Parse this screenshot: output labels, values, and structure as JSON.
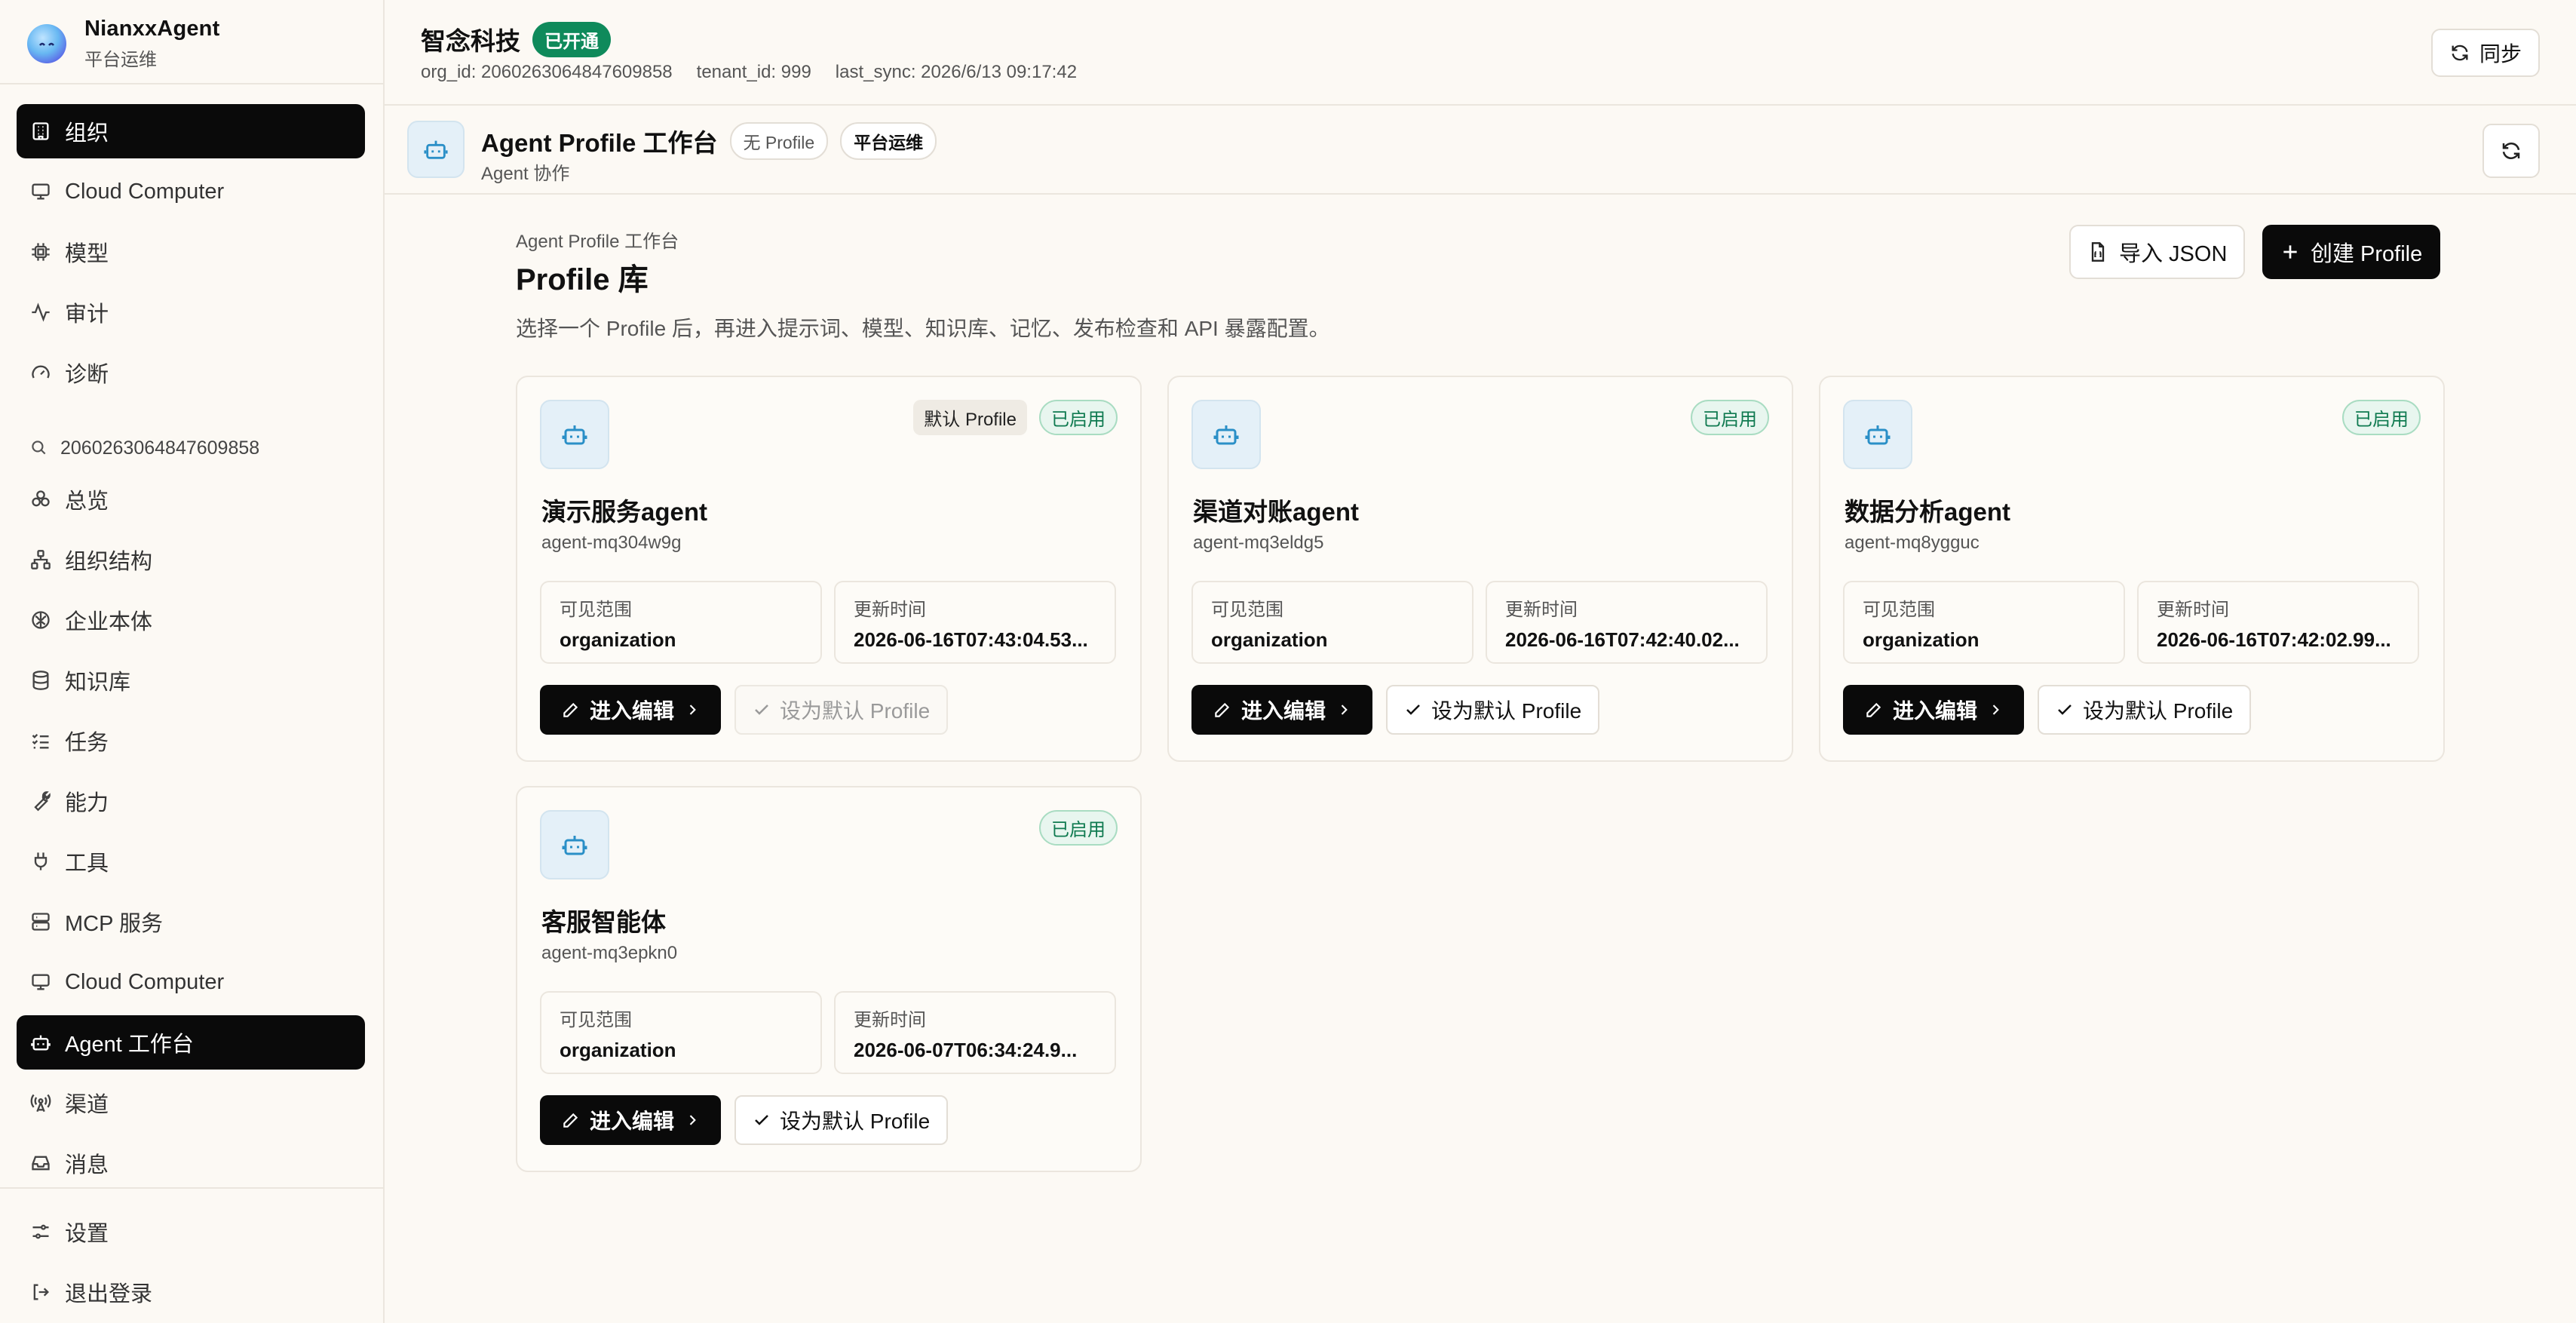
{
  "brand": {
    "name": "NianxxAgent",
    "subtitle": "平台运维"
  },
  "nav": {
    "top_items": [
      {
        "label": "组织",
        "icon": "building-icon"
      },
      {
        "label": "Cloud Computer",
        "icon": "monitor-icon"
      },
      {
        "label": "模型",
        "icon": "chip-icon"
      },
      {
        "label": "审计",
        "icon": "activity-icon"
      },
      {
        "label": "诊断",
        "icon": "gauge-icon"
      }
    ],
    "org_search": "2060263064847609858",
    "org_items": [
      {
        "label": "总览",
        "icon": "overview-icon"
      },
      {
        "label": "组织结构",
        "icon": "org-structure-icon"
      },
      {
        "label": "企业本体",
        "icon": "brain-icon"
      },
      {
        "label": "知识库",
        "icon": "database-icon"
      },
      {
        "label": "任务",
        "icon": "tasks-icon"
      },
      {
        "label": "能力",
        "icon": "wrench-icon"
      },
      {
        "label": "工具",
        "icon": "plug-icon"
      },
      {
        "label": "MCP 服务",
        "icon": "server-icon"
      },
      {
        "label": "Cloud Computer",
        "icon": "monitor-icon"
      },
      {
        "label": "Agent 工作台",
        "icon": "bot-icon"
      },
      {
        "label": "渠道",
        "icon": "antenna-icon"
      },
      {
        "label": "消息",
        "icon": "inbox-icon"
      }
    ],
    "bottom_items": [
      {
        "label": "设置",
        "icon": "sliders-icon"
      },
      {
        "label": "退出登录",
        "icon": "logout-icon"
      }
    ]
  },
  "header": {
    "org_name": "智念科技",
    "status": "已开通",
    "org_id": "org_id: 2060263064847609858",
    "tenant_id": "tenant_id: 999",
    "last_sync": "last_sync: 2026/6/13 09:17:42",
    "sync_label": "同步"
  },
  "subheader": {
    "title": "Agent Profile 工作台",
    "chip_profile": "无 Profile",
    "chip_role": "平台运维",
    "caption": "Agent 协作"
  },
  "main": {
    "breadcrumb": "Agent Profile 工作台",
    "title": "Profile 库",
    "description": "选择一个 Profile 后，再进入提示词、模型、知识库、记忆、发布检查和 API 暴露配置。",
    "import_label": "导入 JSON",
    "create_label": "创建 Profile"
  },
  "labels": {
    "visibility": "可见范围",
    "updated": "更新时间",
    "edit": "进入编辑",
    "set_default": "设为默认 Profile",
    "default_badge": "默认 Profile",
    "enabled_badge": "已启用"
  },
  "profiles": [
    {
      "name": "演示服务agent",
      "id": "agent-mq304w9g",
      "visibility": "organization",
      "updated": "2026-06-16T07:43:04.53...",
      "is_default": true
    },
    {
      "name": "渠道对账agent",
      "id": "agent-mq3eldg5",
      "visibility": "organization",
      "updated": "2026-06-16T07:42:40.02...",
      "is_default": false
    },
    {
      "name": "数据分析agent",
      "id": "agent-mq8ygguc",
      "visibility": "organization",
      "updated": "2026-06-16T07:42:02.99...",
      "is_default": false
    },
    {
      "name": "客服智能体",
      "id": "agent-mq3epkn0",
      "visibility": "organization",
      "updated": "2026-06-07T06:34:24.9...",
      "is_default": false
    }
  ],
  "colors": {
    "accent": "#0a0a0a",
    "status_green": "#0f8a5b",
    "icon_tint": "#2a8fc7",
    "background": "#fcf9f4"
  }
}
